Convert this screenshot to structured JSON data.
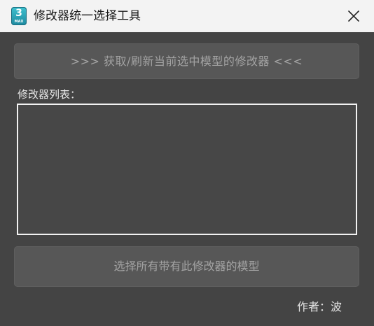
{
  "window": {
    "title": "修改器统一选择工具",
    "icon": {
      "name": "3dsmax-app-icon",
      "number": "3",
      "label": "MAX"
    },
    "close_icon": "close-icon"
  },
  "main": {
    "refresh_button_label": ">>> 获取/刷新当前选中模型的修改器 <<<",
    "list_label": "修改器列表：",
    "list_items": [],
    "select_button_label": "选择所有带有此修改器的模型",
    "author_label": "作者：波"
  },
  "colors": {
    "titlebar_bg": "#f3f3f3",
    "window_bg": "#444444",
    "button_bg": "#575757",
    "button_text": "#a3a3a3",
    "list_border": "#f2f2f2",
    "icon_accent": "#2fa9bb"
  }
}
